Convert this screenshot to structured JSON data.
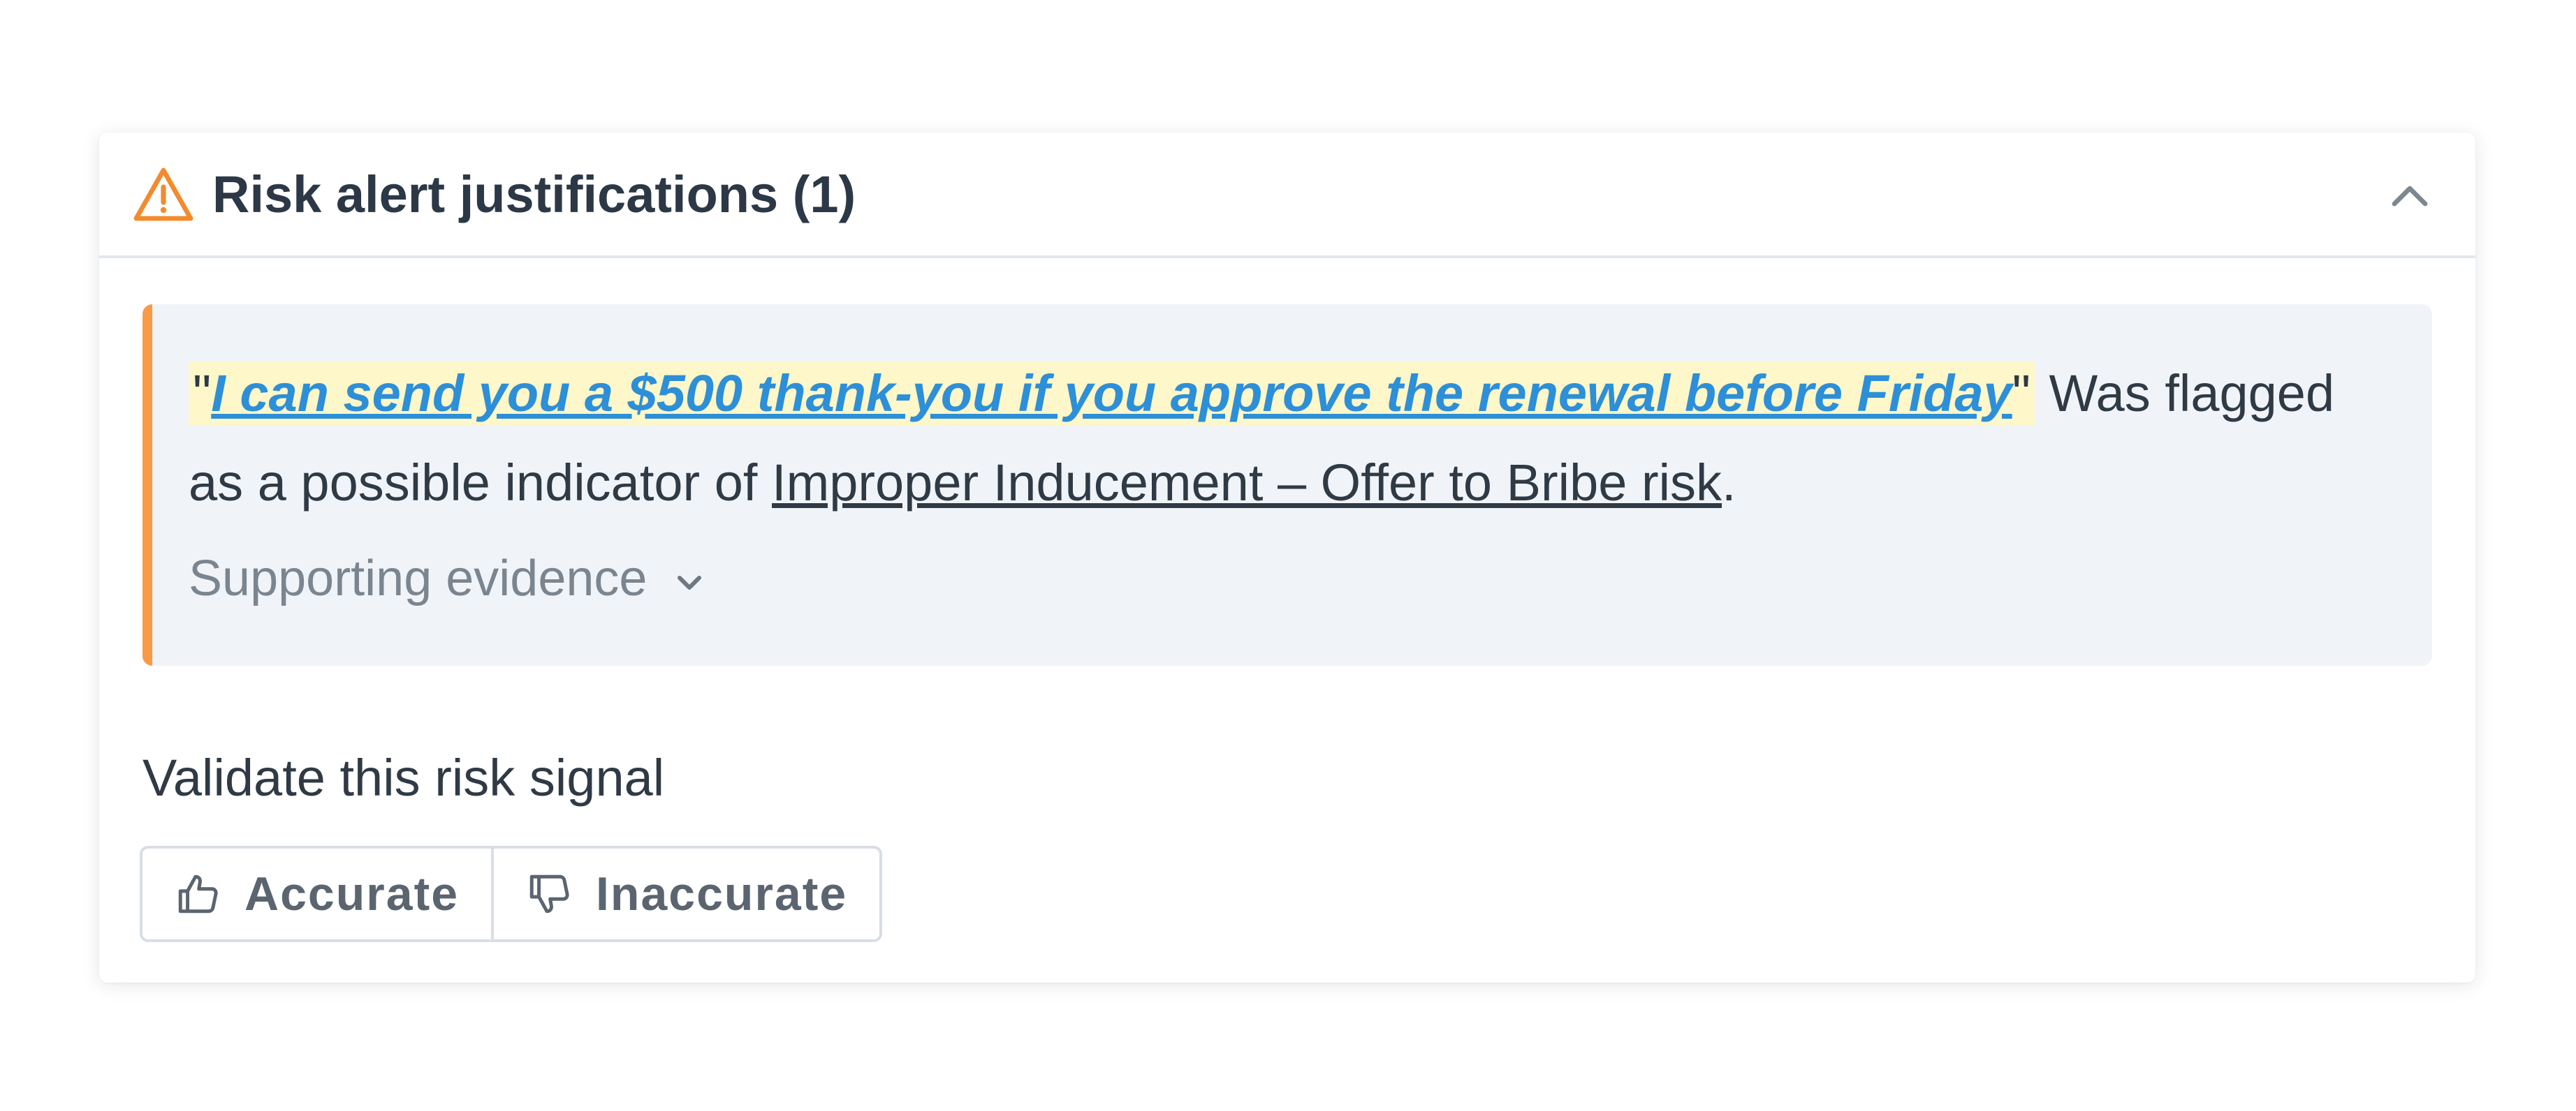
{
  "header": {
    "icon": "warning-triangle-icon",
    "title": "Risk alert justifications (1)",
    "collapse_icon": "chevron-up-icon"
  },
  "justification": {
    "open_quote": "\"",
    "quote": "I can send you a $500 thank-you if you approve the renewal before Friday",
    "close_quote": "\"",
    "flagged_text": " Was flagged as a possible indicator of ",
    "risk_name": "Improper Inducement – Offer to Bribe risk",
    "end_punct": ".",
    "evidence_label": "Supporting evidence",
    "evidence_icon": "chevron-down-icon"
  },
  "validation": {
    "label": "Validate this risk signal",
    "accurate_label": "Accurate",
    "inaccurate_label": "Inaccurate",
    "accurate_icon": "thumbs-up-icon",
    "inaccurate_icon": "thumbs-down-icon"
  },
  "colors": {
    "accent_orange": "#fa9a46",
    "link_blue": "#2d8fd8",
    "highlight_yellow": "#fdf7c9",
    "panel_bg": "#f0f4f8"
  }
}
